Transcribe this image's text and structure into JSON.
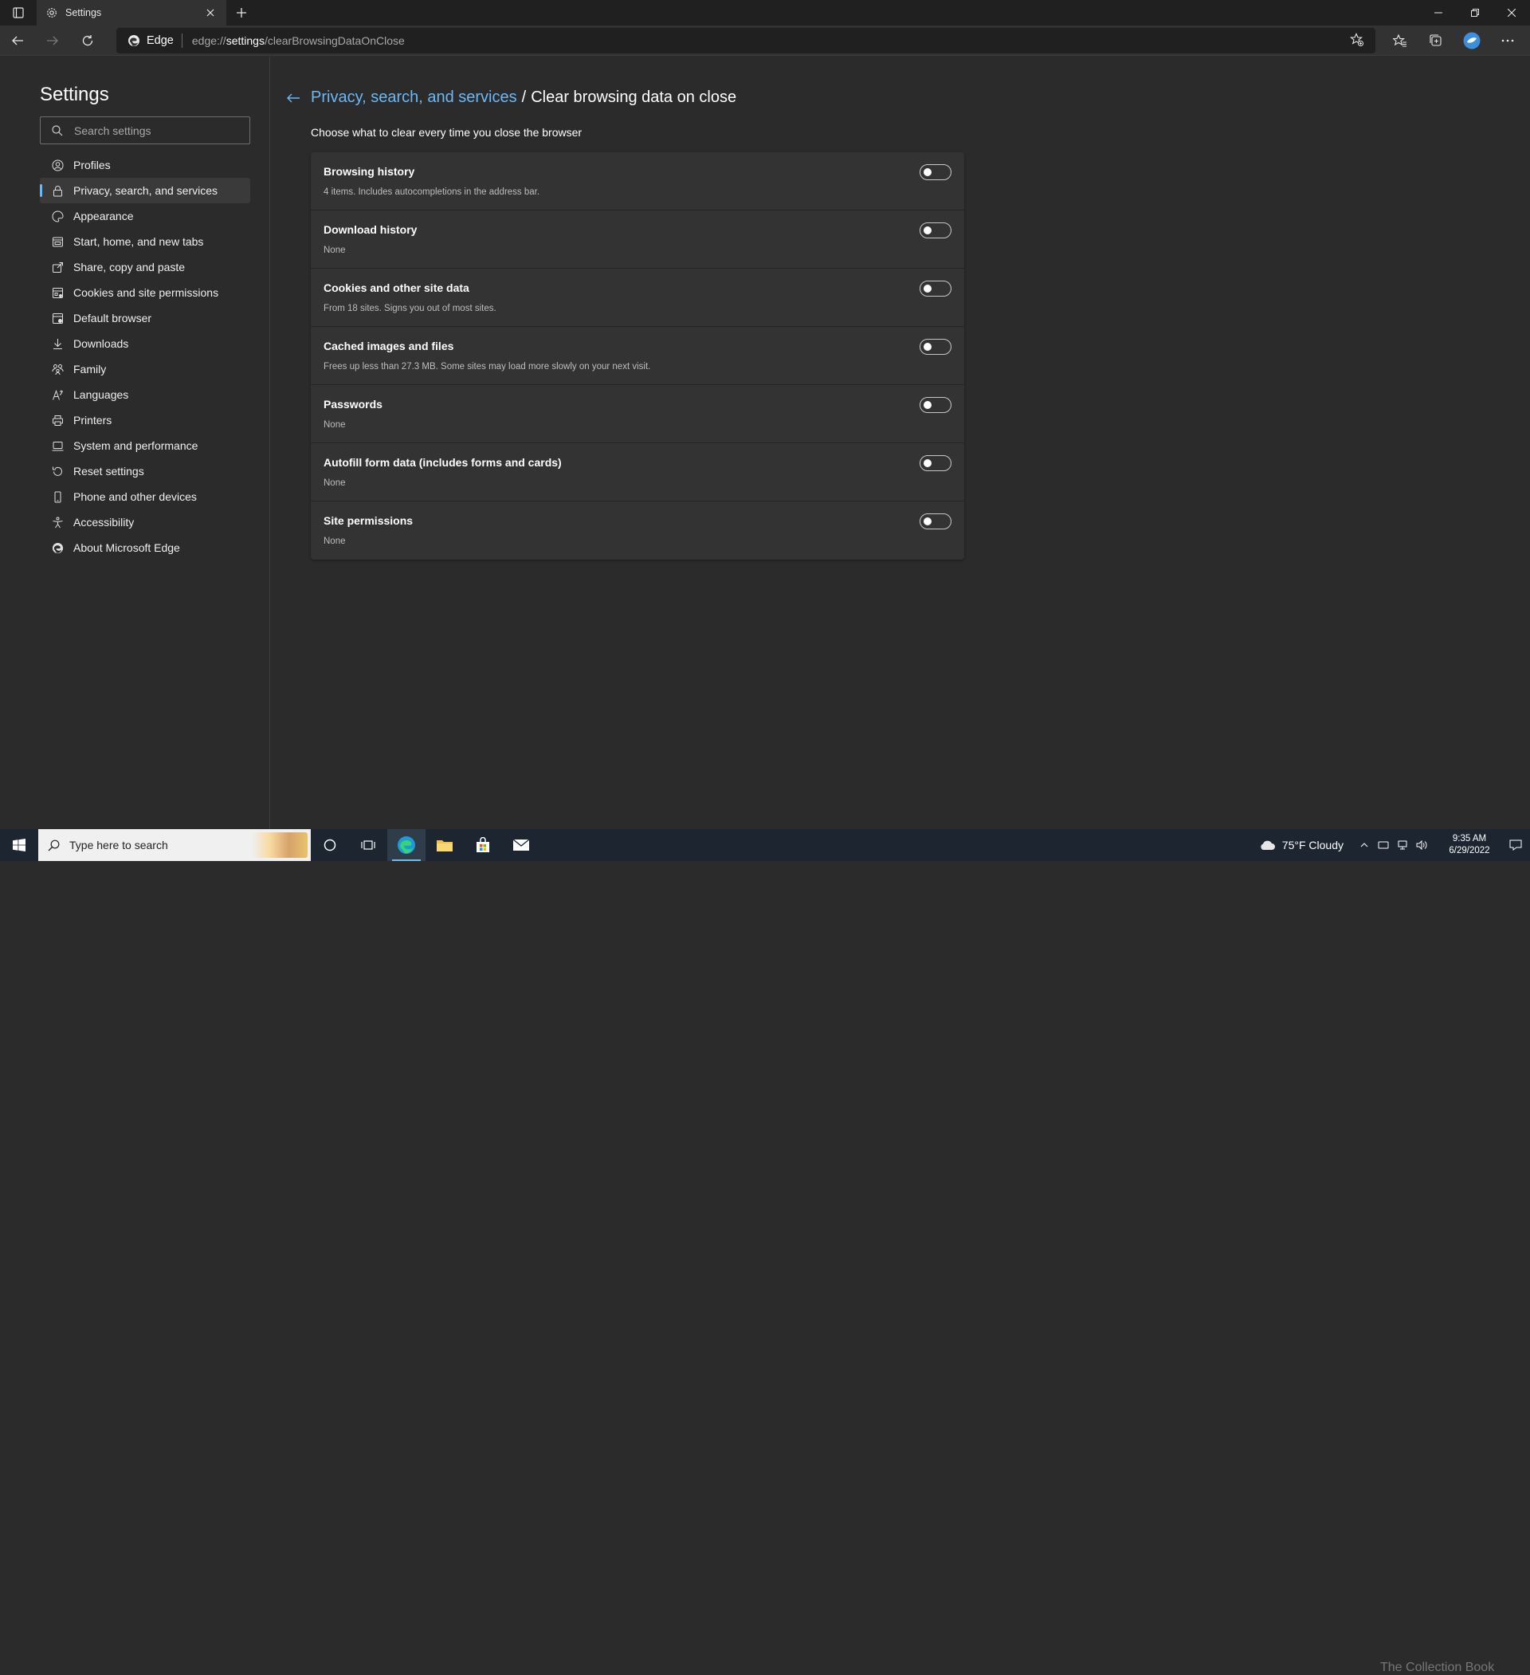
{
  "tab": {
    "title": "Settings"
  },
  "address": {
    "brand": "Edge",
    "url_prefix": "edge://",
    "url_host": "settings",
    "url_path": "/clearBrowsingDataOnClose"
  },
  "sidebar": {
    "title": "Settings",
    "search_placeholder": "Search settings",
    "items": [
      {
        "label": "Profiles",
        "icon": "profile-icon"
      },
      {
        "label": "Privacy, search, and services",
        "icon": "lock-icon",
        "active": true
      },
      {
        "label": "Appearance",
        "icon": "appearance-icon"
      },
      {
        "label": "Start, home, and new tabs",
        "icon": "home-tabs-icon"
      },
      {
        "label": "Share, copy and paste",
        "icon": "share-icon"
      },
      {
        "label": "Cookies and site permissions",
        "icon": "cookies-icon"
      },
      {
        "label": "Default browser",
        "icon": "browser-icon"
      },
      {
        "label": "Downloads",
        "icon": "download-icon"
      },
      {
        "label": "Family",
        "icon": "family-icon"
      },
      {
        "label": "Languages",
        "icon": "languages-icon"
      },
      {
        "label": "Printers",
        "icon": "printer-icon"
      },
      {
        "label": "System and performance",
        "icon": "laptop-icon"
      },
      {
        "label": "Reset settings",
        "icon": "reset-icon"
      },
      {
        "label": "Phone and other devices",
        "icon": "phone-icon"
      },
      {
        "label": "Accessibility",
        "icon": "accessibility-icon"
      },
      {
        "label": "About Microsoft Edge",
        "icon": "edge-icon"
      }
    ]
  },
  "main": {
    "breadcrumb_parent": "Privacy, search, and services",
    "breadcrumb_sep": "/",
    "breadcrumb_current": "Clear browsing data on close",
    "subtitle": "Choose what to clear every time you close the browser",
    "rows": [
      {
        "title": "Browsing history",
        "desc": "4 items. Includes autocompletions in the address bar.",
        "on": false
      },
      {
        "title": "Download history",
        "desc": "None",
        "on": false
      },
      {
        "title": "Cookies and other site data",
        "desc": "From 18 sites. Signs you out of most sites.",
        "on": false
      },
      {
        "title": "Cached images and files",
        "desc": "Frees up less than 27.3 MB. Some sites may load more slowly on your next visit.",
        "on": false
      },
      {
        "title": "Passwords",
        "desc": "None",
        "on": false
      },
      {
        "title": "Autofill form data (includes forms and cards)",
        "desc": "None",
        "on": false
      },
      {
        "title": "Site permissions",
        "desc": "None",
        "on": false
      }
    ]
  },
  "taskbar": {
    "search_placeholder": "Type here to search",
    "weather": "75°F  Cloudy",
    "time": "9:35 AM",
    "date": "6/29/2022",
    "watermark": "The Collection Book"
  },
  "colors": {
    "accent": "#6cb8f6",
    "background": "#2b2b2b",
    "card": "#333333",
    "taskbar": "#1c2530"
  }
}
